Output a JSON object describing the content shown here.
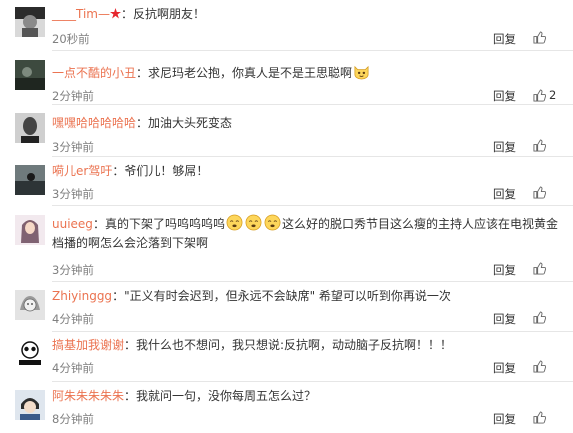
{
  "actions": {
    "reply_label": "回复"
  },
  "colors": {
    "username": "#eb7350",
    "text": "#333333",
    "meta": "#808080",
    "divider": "#e6e6e6"
  },
  "comments": [
    {
      "username": "____Tim—",
      "badge": "red-star-badge",
      "text": "：反抗啊朋友！",
      "time": "20秒前",
      "likes": ""
    },
    {
      "username": "一点不酷的小丑",
      "text": "：求尼玛老公抱，你真人是不是王思聪啊",
      "emoji": "cat-face-emoji",
      "time": "2分钟前",
      "likes": "2"
    },
    {
      "username": "嘿嘿哈哈哈哈哈",
      "text": "：加油大头死变态",
      "time": "3分钟前",
      "likes": ""
    },
    {
      "username": "嗬儿er驾吁",
      "text": "：爷们儿！够屌！",
      "time": "3分钟前",
      "likes": ""
    },
    {
      "username": "uuieeg",
      "text_a": "：真的下架了吗呜呜呜呜",
      "text_b": "这么好的脱口秀节目这么瘦的主持人应该在电视黄金档播的啊怎么会沦落到下架啊",
      "emoji": "crying-face-emoji",
      "time": "3分钟前",
      "likes": ""
    },
    {
      "username": "Zhiyinggg",
      "text": "：\"正义有时会迟到，但永远不会缺席\" 希望可以听到你再说一次",
      "time": "4分钟前",
      "likes": ""
    },
    {
      "username": "搞基加我谢谢",
      "text": "：我什么也不想问，我只想说:反抗啊，动动脑子反抗啊！！！",
      "time": "4分钟前",
      "likes": ""
    },
    {
      "username": "阿朱朱朱朱朱",
      "text": "：我就问一句，没你每周五怎么过？",
      "time": "8分钟前",
      "likes": ""
    }
  ]
}
